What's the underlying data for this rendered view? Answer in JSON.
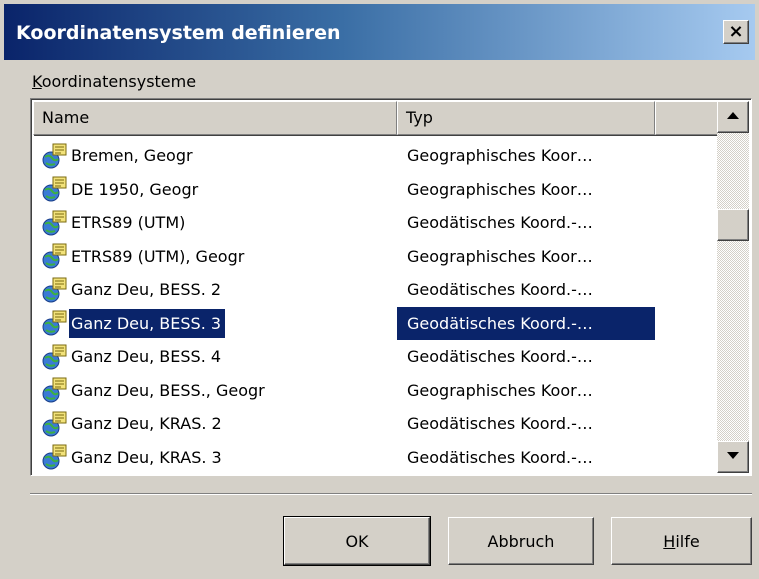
{
  "dialog": {
    "title": "Koordinatensystem definieren",
    "close_label": "×"
  },
  "list": {
    "group_label_accesskey": "K",
    "group_label_rest": "oordinatensysteme",
    "columns": [
      "Name",
      "Typ",
      ""
    ],
    "rows": [
      {
        "name": "Bremen, Geogr",
        "typ": "Geographisches Koor…",
        "icon": "coordinate-system-icon"
      },
      {
        "name": "DE 1950, Geogr",
        "typ": "Geographisches Koor…",
        "icon": "coordinate-system-icon"
      },
      {
        "name": "ETRS89 (UTM)",
        "typ": "Geodätisches Koord.-…",
        "icon": "coordinate-system-icon"
      },
      {
        "name": "ETRS89 (UTM), Geogr",
        "typ": "Geographisches Koor…",
        "icon": "coordinate-system-icon"
      },
      {
        "name": "Ganz Deu, BESS. 2",
        "typ": "Geodätisches Koord.-…",
        "icon": "coordinate-system-icon"
      },
      {
        "name": "Ganz Deu, BESS. 3",
        "typ": "Geodätisches Koord.-…",
        "icon": "coordinate-system-icon",
        "selected": true
      },
      {
        "name": "Ganz Deu, BESS. 4",
        "typ": "Geodätisches Koord.-…",
        "icon": "coordinate-system-icon"
      },
      {
        "name": "Ganz Deu, BESS., Geogr",
        "typ": "Geographisches Koor…",
        "icon": "coordinate-system-icon"
      },
      {
        "name": "Ganz Deu, KRAS. 2",
        "typ": "Geodätisches Koord.-…",
        "icon": "coordinate-system-icon"
      },
      {
        "name": "Ganz Deu, KRAS. 3",
        "typ": "Geodätisches Koord.-…",
        "icon": "coordinate-system-icon"
      }
    ]
  },
  "buttons": {
    "ok": "OK",
    "cancel": "Abbruch",
    "help_accesskey": "H",
    "help_rest": "ilfe"
  },
  "colors": {
    "selection": "#0a246a",
    "face": "#d4d0c8"
  }
}
